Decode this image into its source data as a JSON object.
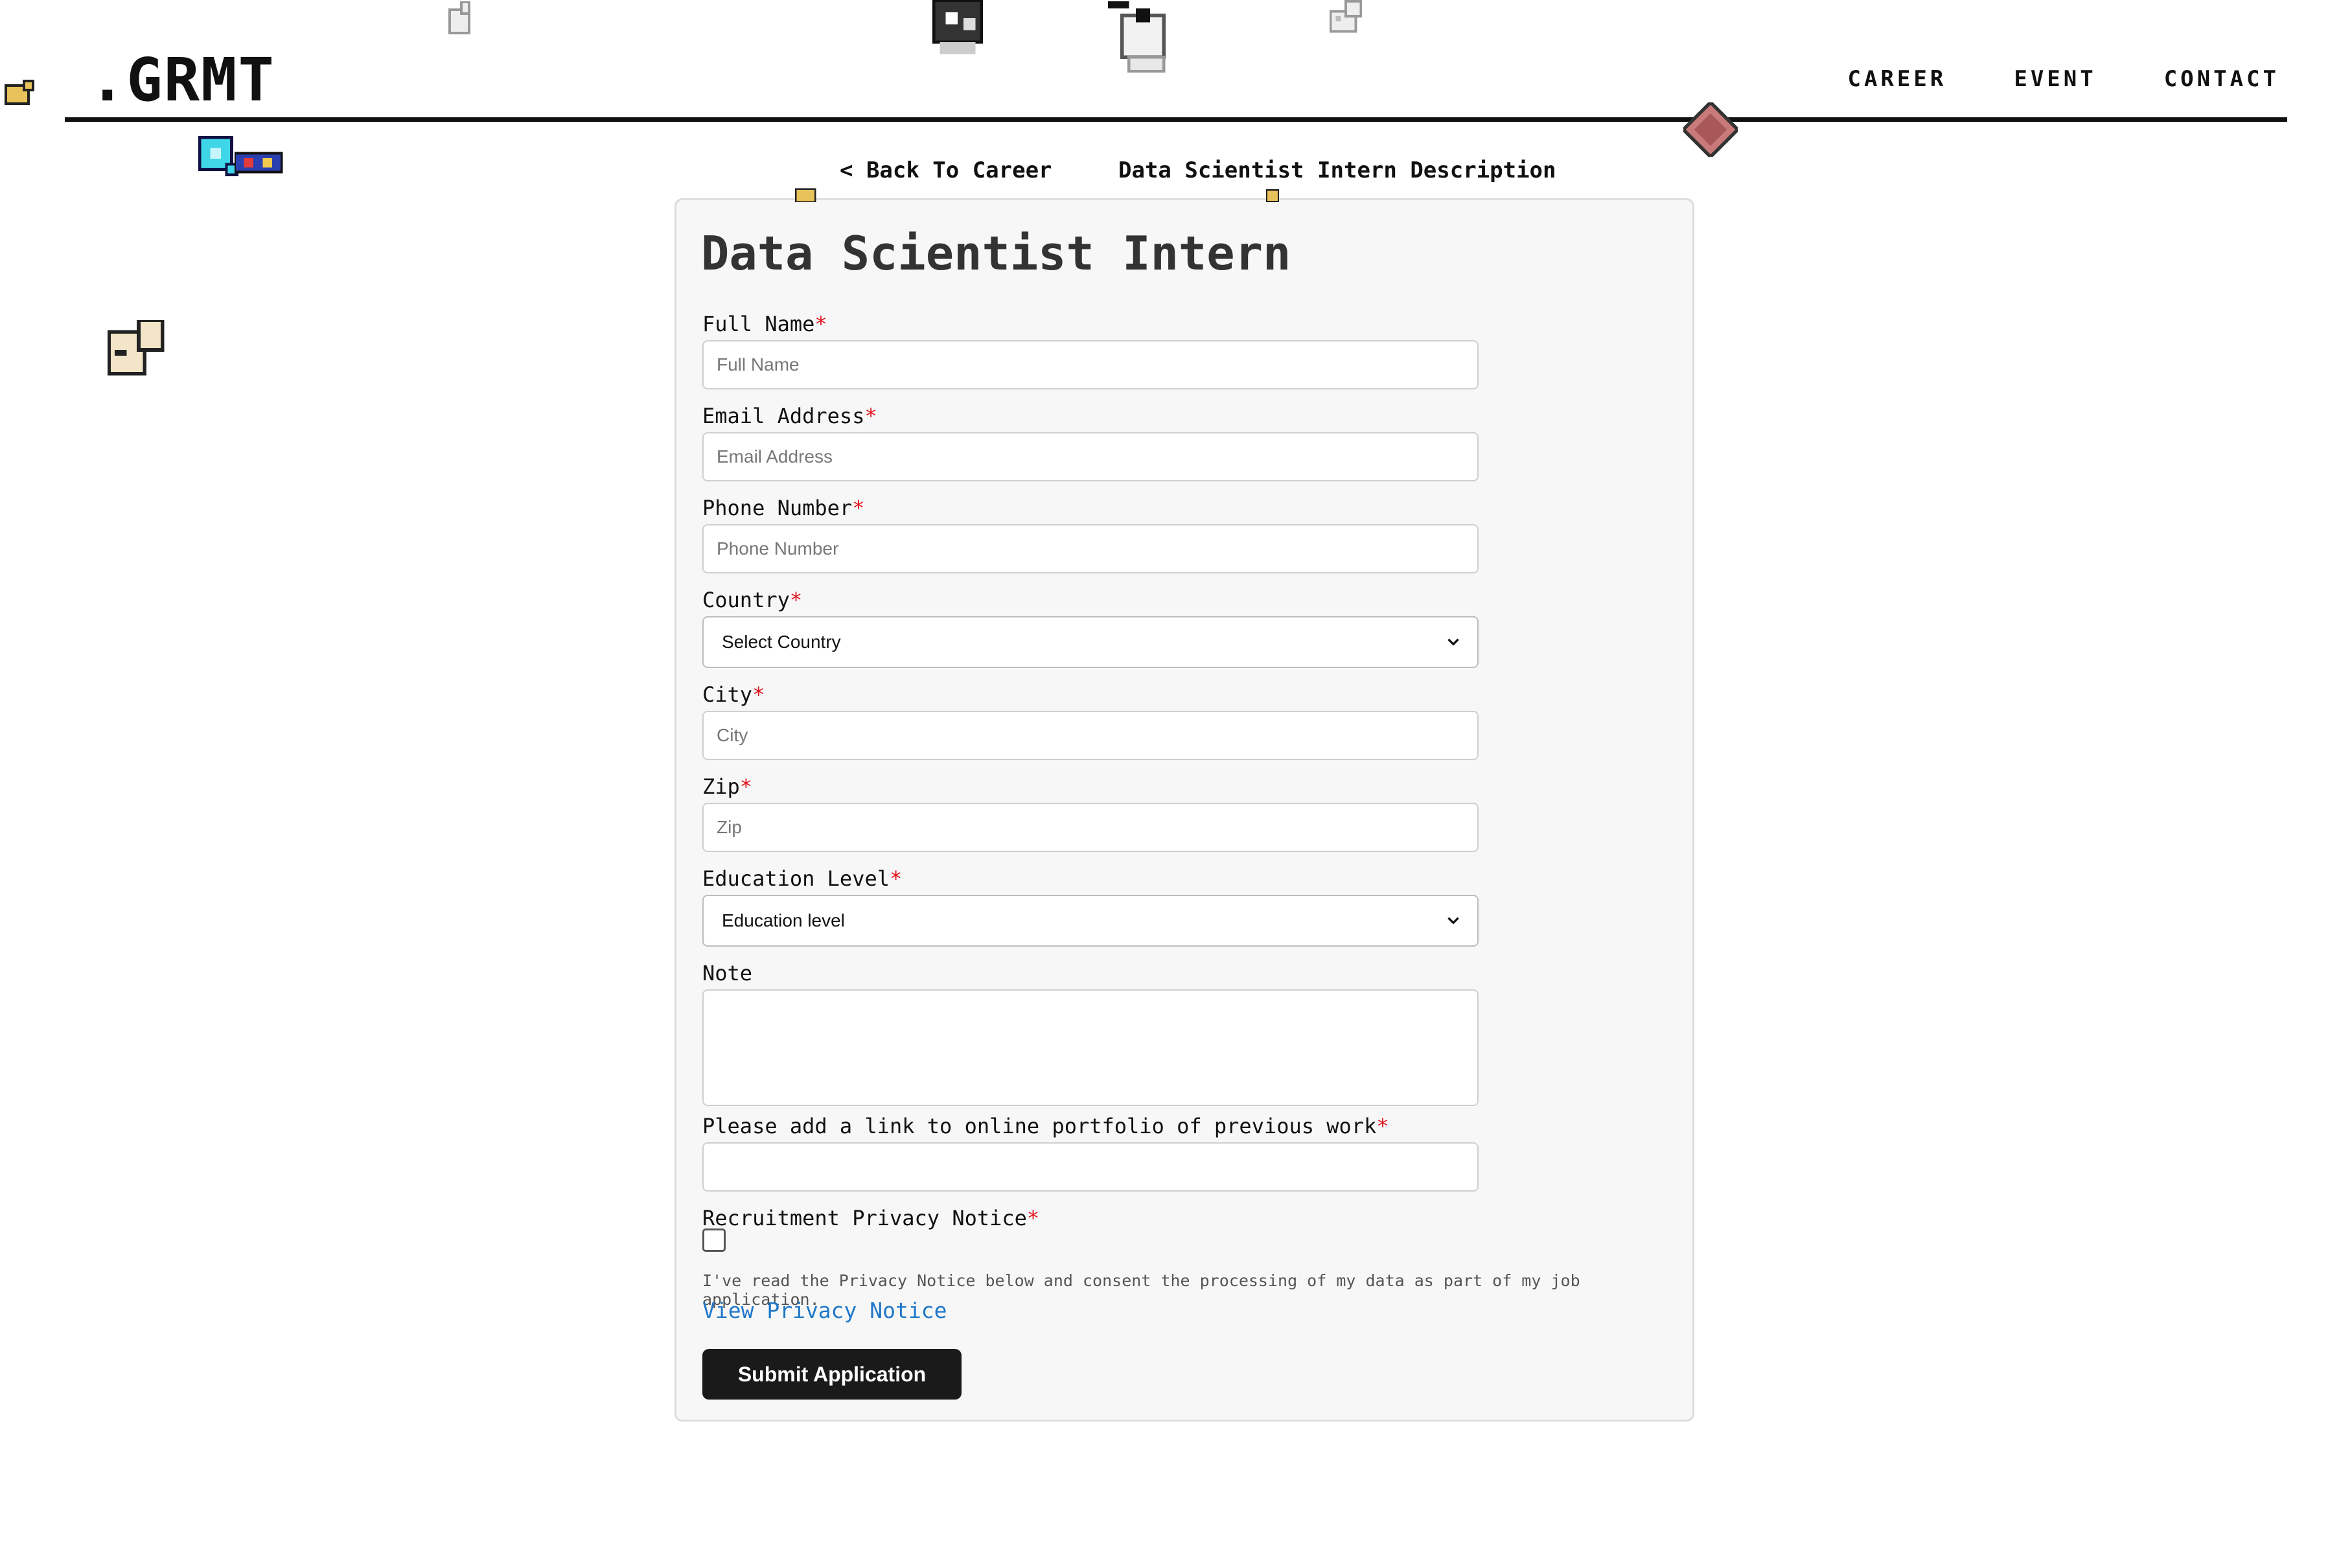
{
  "header": {
    "logo": ".GRMT",
    "nav": [
      "CAREER",
      "EVENT",
      "CONTACT"
    ]
  },
  "breadcrumb": {
    "back": "< Back To Career",
    "current": "Data Scientist Intern Description"
  },
  "form": {
    "title": "Data Scientist Intern",
    "fields": {
      "full_name": {
        "label": "Full Name",
        "required": "*",
        "placeholder": "Full Name"
      },
      "email": {
        "label": "Email Address",
        "required": "*",
        "placeholder": "Email Address"
      },
      "phone": {
        "label": "Phone Number",
        "required": "*",
        "placeholder": "Phone Number"
      },
      "country": {
        "label": "Country",
        "required": "*",
        "selected": "Select Country"
      },
      "city": {
        "label": "City",
        "required": "*",
        "placeholder": "City"
      },
      "zip": {
        "label": "Zip",
        "required": "*",
        "placeholder": "Zip"
      },
      "education": {
        "label": "Education Level",
        "required": "*",
        "selected": "Education level"
      },
      "note": {
        "label": "Note",
        "value": ""
      },
      "portfolio": {
        "label": "Please add a link to online portfolio of previous work",
        "required": "*",
        "placeholder": ""
      },
      "privacy": {
        "label": "Recruitment Privacy Notice",
        "required": "*",
        "checked": false
      }
    },
    "consent_text": "I've read the Privacy Notice below and consent the processing of my data as part of my job application.",
    "privacy_link": "View Privacy Notice",
    "submit_label": "Submit Application"
  },
  "colors": {
    "accent_link": "#1e77c8",
    "required": "#e0141e",
    "button": "#1a1a1a",
    "card_bg": "#f7f7f7"
  },
  "icons": [
    "chevron-down-icon",
    "pixel-sprite-icon"
  ]
}
